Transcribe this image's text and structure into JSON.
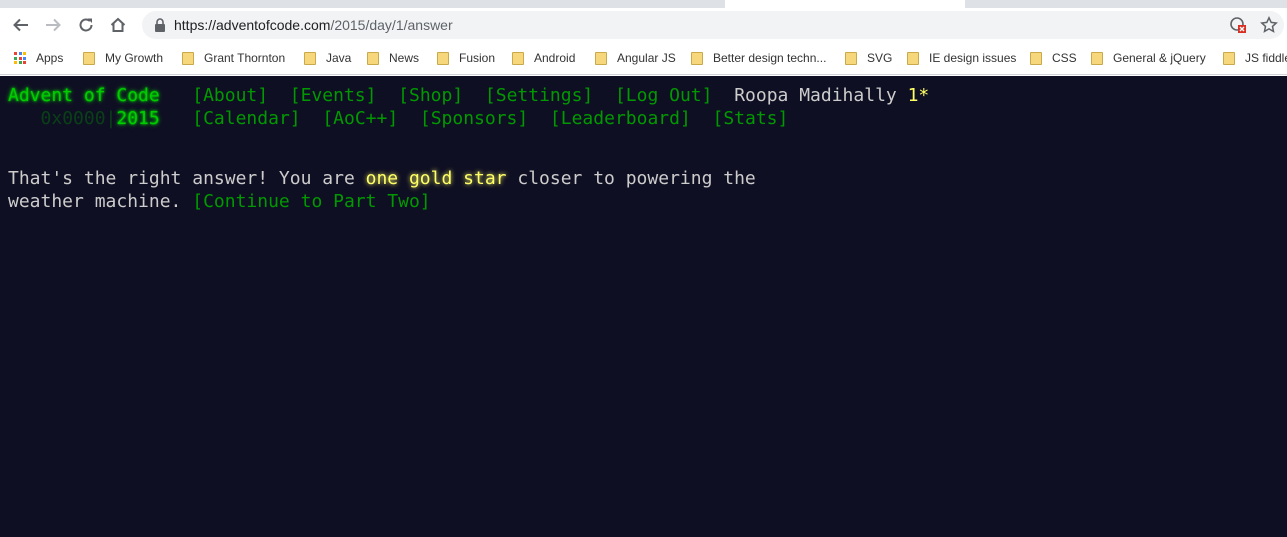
{
  "browser": {
    "url_host": "https://adventofcode.com",
    "url_path": "/2015/day/1/answer",
    "bookmarks": [
      "Apps",
      "My Growth",
      "Grant Thornton",
      "Java",
      "News",
      "Fusion",
      "Android",
      "Angular JS",
      "Better design techn...",
      "SVG",
      "IE design issues",
      "CSS",
      "General & jQuery",
      "JS fiddle"
    ]
  },
  "header": {
    "title": "Advent of Code",
    "nav": [
      "[About]",
      "[Events]",
      "[Shop]",
      "[Settings]",
      "[Log Out]"
    ],
    "user": "Roopa Madihally",
    "stars": "1*",
    "year_prefix": "0x0000|",
    "year": "2015",
    "subnav": [
      "[Calendar]",
      "[AoC++]",
      "[Sponsors]",
      "[Leaderboard]",
      "[Stats]"
    ]
  },
  "main": {
    "text_before": "That's the right answer! You are ",
    "highlight": "one gold star",
    "text_after": " closer to powering the",
    "line2": "weather machine. ",
    "continue_link": "[Continue to Part Two]"
  },
  "colors": {
    "background": "#0f0f23",
    "title_green": "#00cc00",
    "link_green": "#009900",
    "text": "#cccccc",
    "gold": "#ffff66"
  }
}
